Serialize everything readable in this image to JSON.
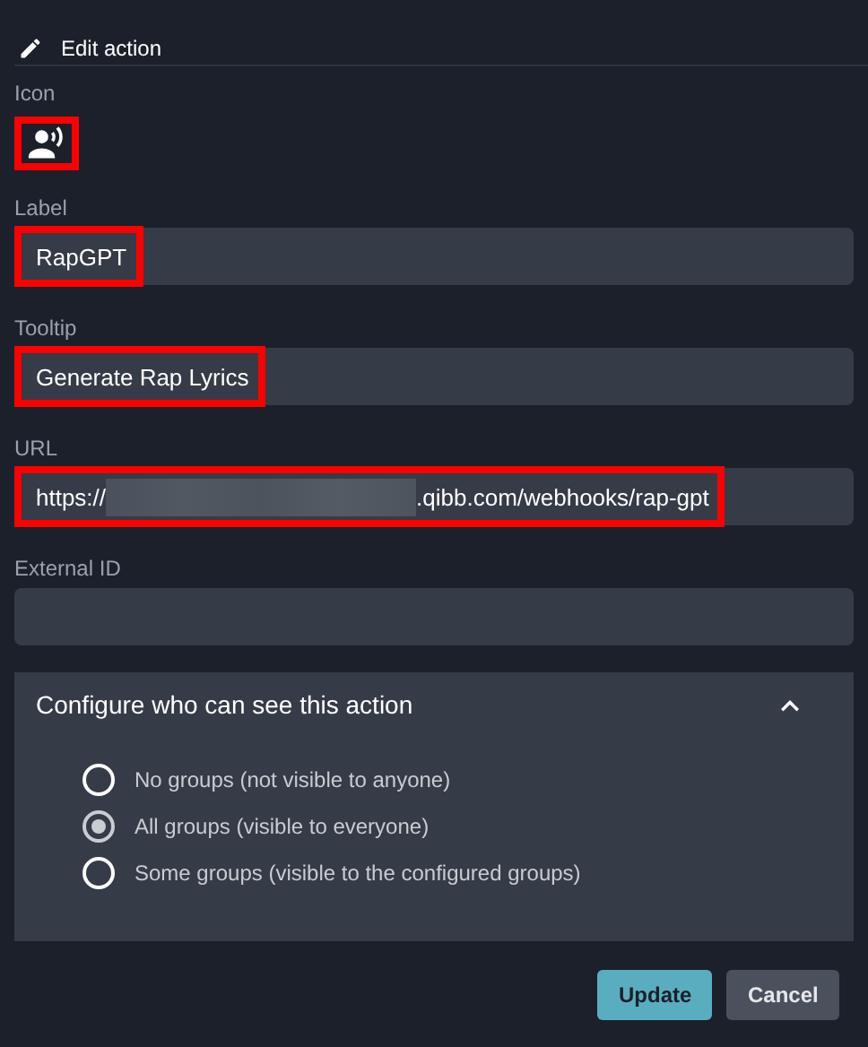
{
  "header": {
    "title": "Edit action"
  },
  "icon_field": {
    "label": "Icon",
    "highlighted": true
  },
  "fields": [
    {
      "kind": "text",
      "label": "Label",
      "value": "RapGPT",
      "highlighted": true
    },
    {
      "kind": "text",
      "label": "Tooltip",
      "value": "Generate Rap Lyrics",
      "highlighted": true
    },
    {
      "kind": "url",
      "label": "URL",
      "prefix": "https://",
      "suffix": ".qibb.com/webhooks/rap-gpt",
      "redacted": true,
      "highlighted": true
    },
    {
      "kind": "text",
      "label": "External ID"
    }
  ],
  "visibility": {
    "title": "Configure who can see this action",
    "expanded": true,
    "options": [
      {
        "label": "No groups (not visible to anyone)",
        "selected": false
      },
      {
        "label": "All groups (visible to everyone)",
        "selected": true
      },
      {
        "label": "Some groups (visible to the configured groups)",
        "selected": false
      }
    ]
  },
  "buttons": [
    {
      "kind": "primary",
      "label": "Update"
    },
    {
      "kind": "secondary",
      "label": "Cancel"
    }
  ]
}
